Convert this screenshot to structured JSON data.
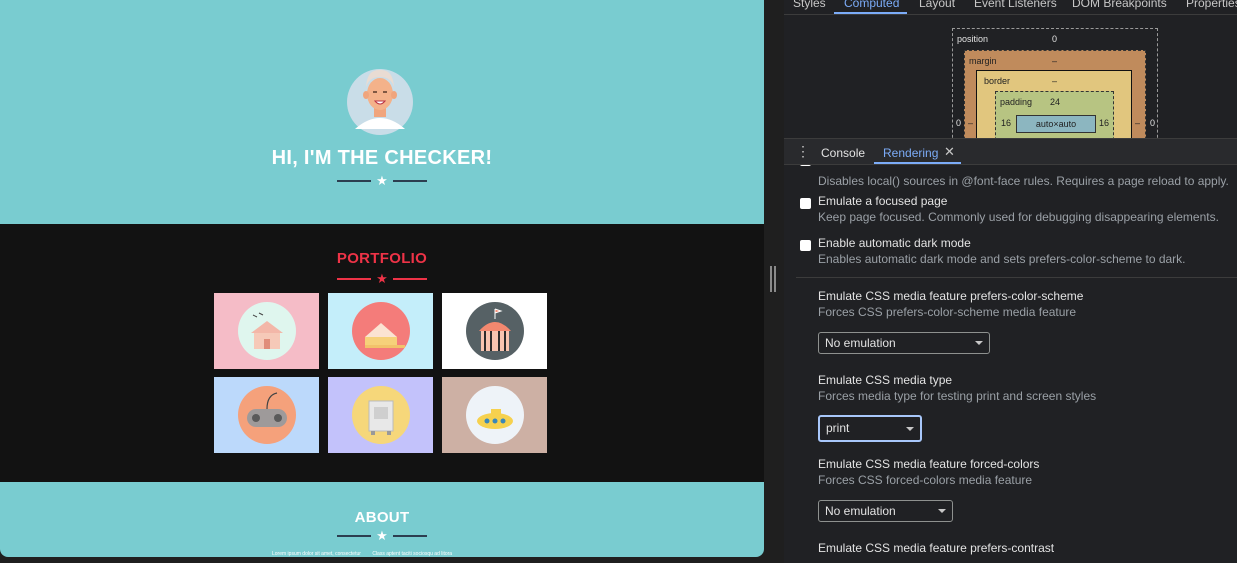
{
  "page": {
    "hero": {
      "title": "HI, I'M THE CHECKER!"
    },
    "portfolio": {
      "title": "PORTFOLIO",
      "tiles": [
        {
          "name": "cabin",
          "bg": "#f5bcc7"
        },
        {
          "name": "cake",
          "bg": "#c4eefa"
        },
        {
          "name": "circus-tent",
          "bg": "#ffffff"
        },
        {
          "name": "game-controller",
          "bg": "#bcd9fb"
        },
        {
          "name": "safe",
          "bg": "#c3c2fb"
        },
        {
          "name": "submarine",
          "bg": "#cdb0a4"
        }
      ]
    },
    "about": {
      "title": "ABOUT",
      "col1": "Lorem ipsum dolor sit amet, consectetur",
      "col2": "Class aptent taciti sociosqu ad litora"
    }
  },
  "devtools": {
    "top_tabs": [
      "Styles",
      "Computed",
      "Layout",
      "Event Listeners",
      "DOM Breakpoints",
      "Properties"
    ],
    "active_top_tab": "Computed",
    "box_model": {
      "position_label": "position",
      "position_value": "0",
      "margin_label": "margin",
      "margin_value": "–",
      "border_label": "border",
      "border_value": "–",
      "padding_label": "padding",
      "padding_value": "24",
      "padding_left": "16",
      "padding_right": "16",
      "content": "auto×auto",
      "left_outer": "0",
      "right_outer": "0",
      "margin_left": "–",
      "margin_right": "–"
    },
    "drawer": {
      "tabs": [
        "Console",
        "Rendering"
      ],
      "active_tab": "Rendering"
    },
    "rendering": {
      "partial_desc": "Disables local() sources in @font-face rules. Requires a page reload to apply.",
      "checkboxes": [
        {
          "title": "Emulate a focused page",
          "desc": "Keep page focused. Commonly used for debugging disappearing elements.",
          "checked": false
        },
        {
          "title": "Enable automatic dark mode",
          "desc": "Enables automatic dark mode and sets prefers-color-scheme to dark.",
          "checked": false
        }
      ],
      "emulations": [
        {
          "title": "Emulate CSS media feature prefers-color-scheme",
          "desc": "Forces CSS prefers-color-scheme media feature",
          "value": "No emulation"
        },
        {
          "title": "Emulate CSS media type",
          "desc": "Forces media type for testing print and screen styles",
          "value": "print"
        },
        {
          "title": "Emulate CSS media feature forced-colors",
          "desc": "Forces CSS forced-colors media feature",
          "value": "No emulation"
        },
        {
          "title": "Emulate CSS media feature prefers-contrast",
          "desc": "",
          "value": ""
        }
      ]
    }
  }
}
